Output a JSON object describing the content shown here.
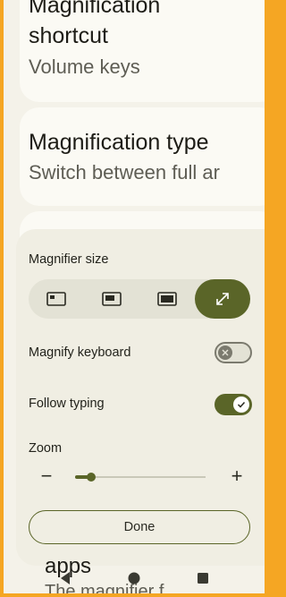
{
  "background": {
    "shortcut_title_top": "Magnification",
    "shortcut_title": "shortcut",
    "shortcut_value": "Volume keys",
    "type_title": "Magnification type",
    "type_value": "Switch between full ar",
    "peek_title": "apps",
    "peek_sub": "The magnifier f"
  },
  "panel": {
    "size_label": "Magnifier size",
    "size_options": [
      {
        "icon": "magnifier-small-icon",
        "selected": false
      },
      {
        "icon": "magnifier-medium-icon",
        "selected": false
      },
      {
        "icon": "magnifier-large-icon",
        "selected": false
      },
      {
        "icon": "fullscreen-expand-icon",
        "selected": true
      }
    ],
    "magnify_keyboard_label": "Magnify keyboard",
    "magnify_keyboard_on": false,
    "follow_typing_label": "Follow typing",
    "follow_typing_on": true,
    "zoom_label": "Zoom",
    "zoom_minus": "−",
    "zoom_plus": "+",
    "zoom_level_fraction": 0.12,
    "done_label": "Done"
  },
  "colors": {
    "accent": "#5a6528",
    "frame": "#f5a623",
    "surface": "#f0eee3"
  },
  "nav": {
    "icons": [
      "back-icon",
      "home-icon",
      "recents-icon"
    ]
  }
}
